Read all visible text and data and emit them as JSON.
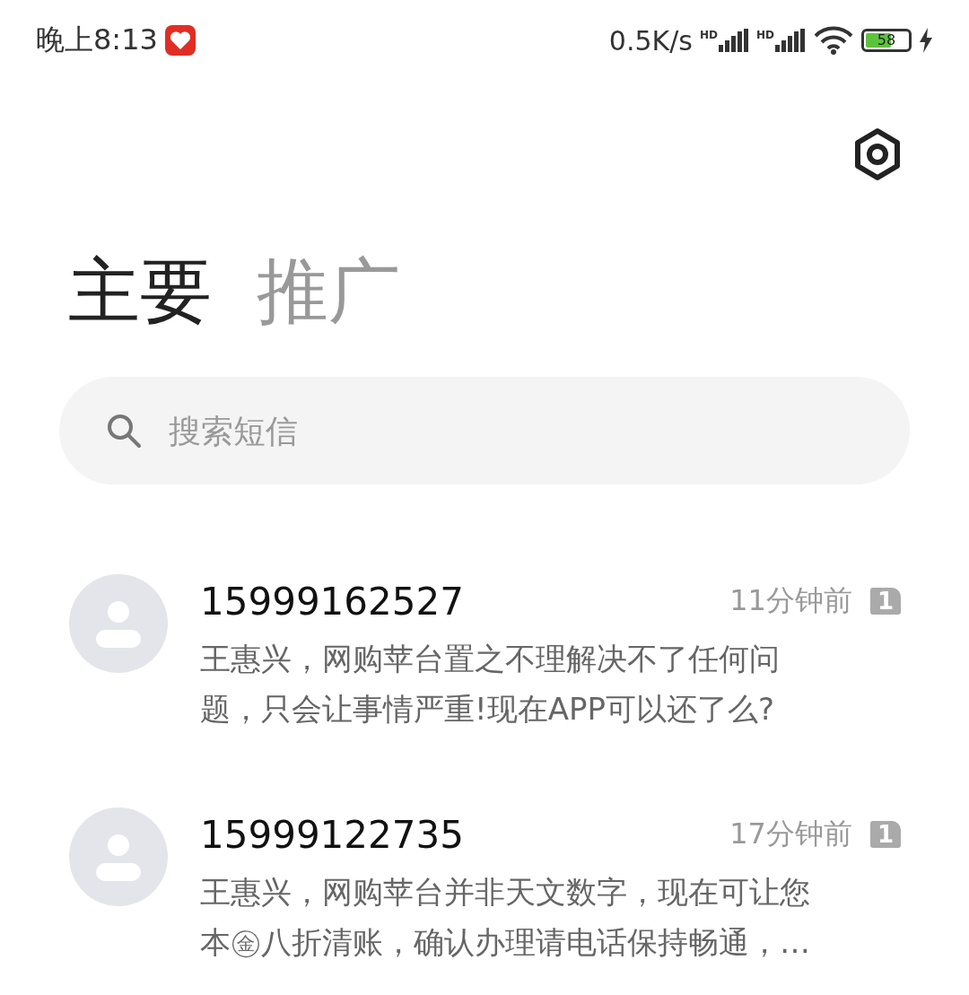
{
  "status_bar": {
    "time": "晚上8:13",
    "speed": "0.5K/s",
    "sim_labels": [
      "HD",
      "HD"
    ],
    "battery": "58"
  },
  "tabs": [
    {
      "label": "主要",
      "selected": true
    },
    {
      "label": "推广",
      "selected": false
    }
  ],
  "search": {
    "placeholder": "搜索短信"
  },
  "messages": [
    {
      "sender": "15999162527",
      "time": "11分钟前",
      "sim": "1",
      "preview": "王惠兴，网购苹台置之不理解决不了任何问题，只会让事情严重!现在APP可以还了么?"
    },
    {
      "sender": "15999122735",
      "time": "17分钟前",
      "sim": "1",
      "preview": "王惠兴，网购苹台并非天文数字，现在可让您本㊎八折清账，确认办理请电话保持畅通，…"
    }
  ]
}
